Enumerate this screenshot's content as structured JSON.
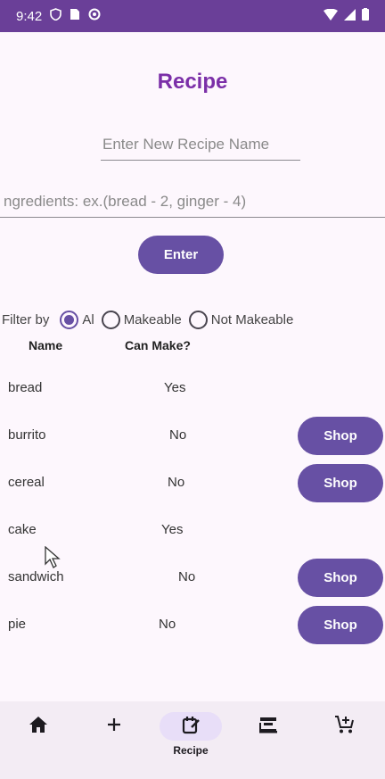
{
  "status_bar": {
    "time": "9:42",
    "bg_color": "#6a3f98"
  },
  "title": "Recipe",
  "name_input": {
    "placeholder": "Enter New Recipe Name",
    "value": ""
  },
  "ingredients_input": {
    "placeholder": "ngredients: ex.(bread - 2, ginger - 4)",
    "value": ""
  },
  "enter_button": "Enter",
  "filter": {
    "label": "Filter by",
    "options": [
      "Al",
      "Makeable",
      "Not Makeable"
    ],
    "selected": "Al"
  },
  "table": {
    "headers": [
      "Name",
      "Can Make?"
    ],
    "rows": [
      {
        "name": "bread",
        "can_make": "Yes",
        "action": ""
      },
      {
        "name": "burrito",
        "can_make": "No",
        "action": "Shop"
      },
      {
        "name": "cereal",
        "can_make": "No",
        "action": "Shop"
      },
      {
        "name": "cake",
        "can_make": "Yes",
        "action": ""
      },
      {
        "name": "sandwich",
        "can_make": "No",
        "action": "Shop"
      },
      {
        "name": "pie",
        "can_make": "No",
        "action": "Shop"
      }
    ]
  },
  "bottom_nav": {
    "items": [
      {
        "icon": "home-icon",
        "label": ""
      },
      {
        "icon": "plus-icon",
        "label": ""
      },
      {
        "icon": "recipe-icon",
        "label": "Recipe",
        "active": true
      },
      {
        "icon": "kitchen-icon",
        "label": ""
      },
      {
        "icon": "cart-icon",
        "label": ""
      }
    ]
  },
  "colors": {
    "accent": "#6750a4",
    "title": "#7b2fa8",
    "background": "#fdf7fd"
  }
}
